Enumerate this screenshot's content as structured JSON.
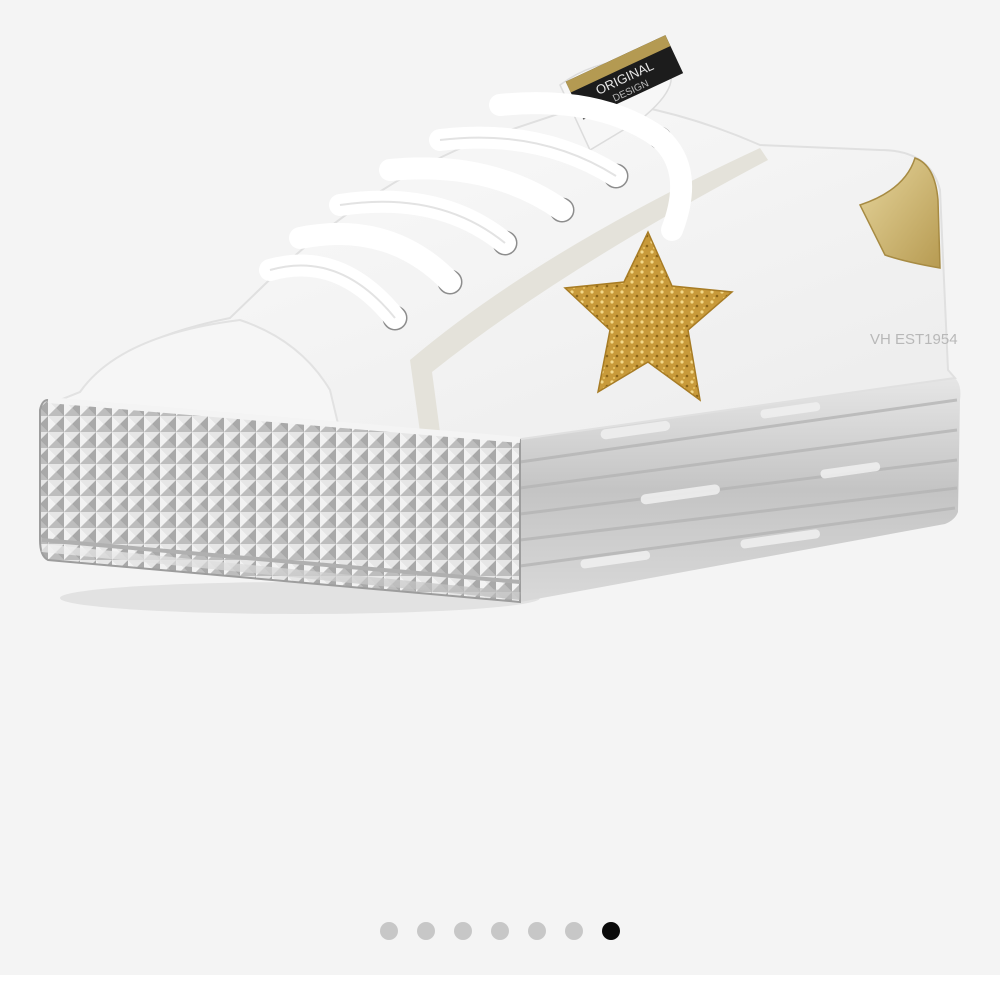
{
  "gallery": {
    "image_alt": "White platform sneaker with gold glitter star",
    "heel_print": "VH EST1954",
    "tongue_label_line1": "ORIGINAL",
    "tongue_label_line2": "DESIGN",
    "dots": [
      {
        "active": false
      },
      {
        "active": false
      },
      {
        "active": false
      },
      {
        "active": false
      },
      {
        "active": false
      },
      {
        "active": false
      },
      {
        "active": true
      }
    ],
    "current_index": 7,
    "total_images": 7
  },
  "colors": {
    "background": "#f4f4f4",
    "dot_inactive": "#c7c7c7",
    "dot_active": "#0a0a0a",
    "star_gold": "#c89a3a",
    "heel_gold": "#cdb778",
    "sole_silver": "#c9c9c9"
  }
}
